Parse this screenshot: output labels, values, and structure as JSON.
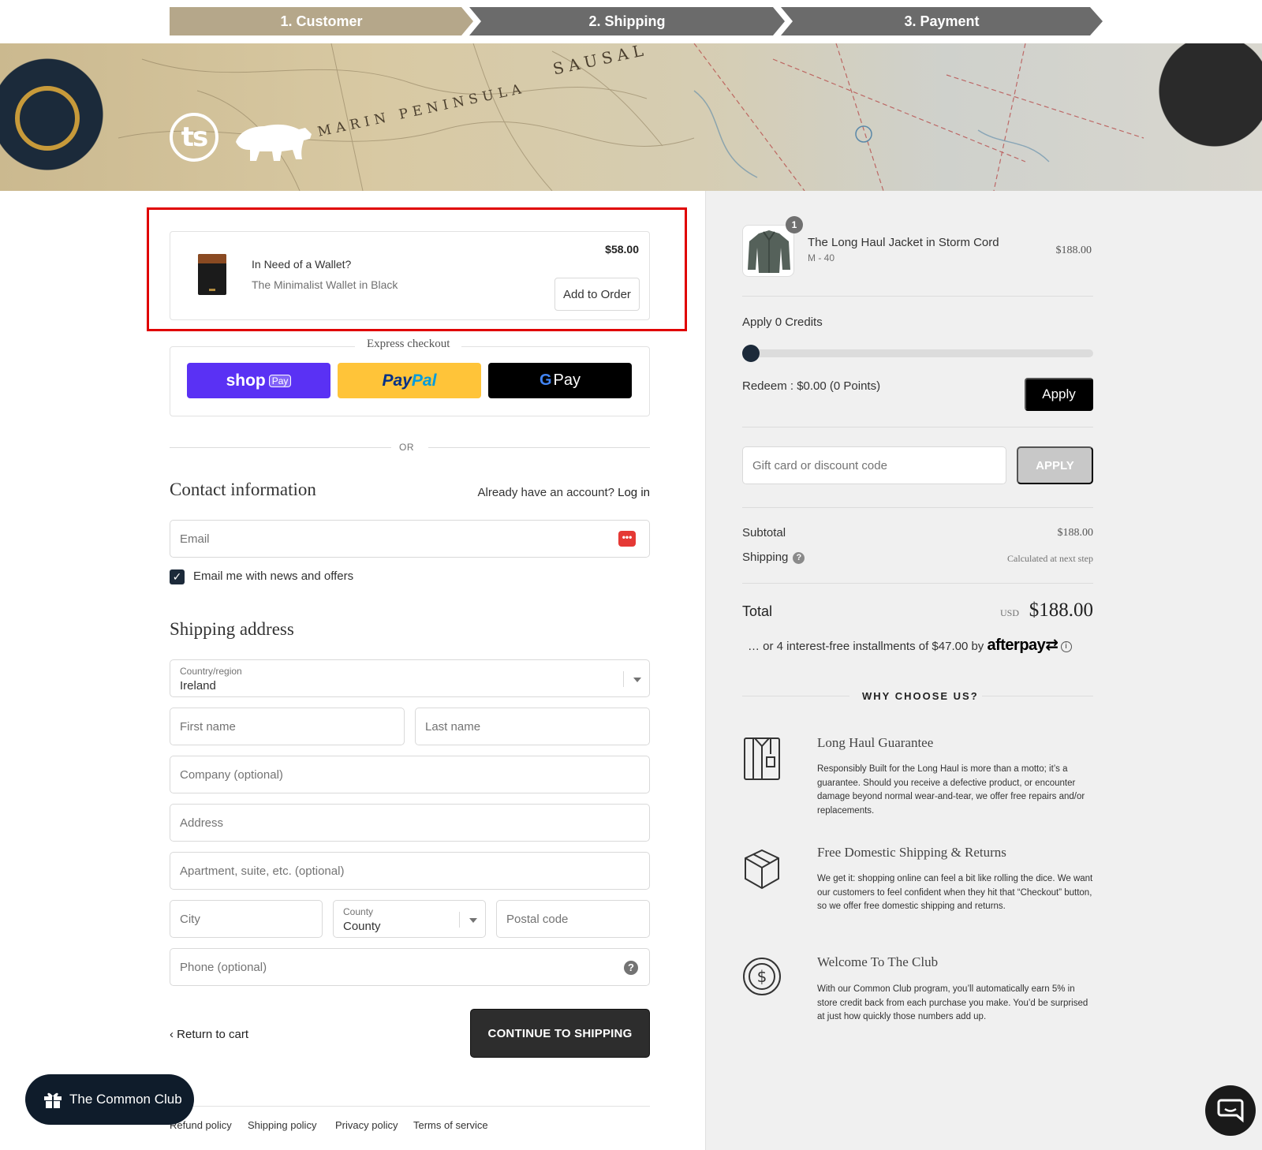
{
  "steps": [
    {
      "label": "1. Customer",
      "state": "active"
    },
    {
      "label": "2. Shipping",
      "state": "upcoming"
    },
    {
      "label": "3. Payment",
      "state": "upcoming"
    }
  ],
  "colors": {
    "step_active": "#b5a78a",
    "step_inactive": "#6b6b6b",
    "highlight_border": "#e00000",
    "shop_pay": "#5a31f4",
    "paypal": "#ffc439",
    "continue_button": "#2d2d2d",
    "right_panel_bg": "#f0f0f0"
  },
  "banner": {
    "logo_text": "ts",
    "icons": [
      "ts-logo-icon",
      "bear-icon"
    ],
    "map_labels": [
      "MARIN PENINSULA",
      "SAUSAL"
    ]
  },
  "upsell": {
    "title": "In Need of a Wallet?",
    "subtitle": "The Minimalist Wallet in Black",
    "price": "$58.00",
    "button_label": "Add to Order"
  },
  "express_checkout": {
    "label": "Express checkout",
    "buttons": {
      "shop": {
        "text": "shop",
        "tag": "Pay"
      },
      "paypal": {
        "part1": "Pay",
        "part2": "Pal"
      },
      "gpay": {
        "g": "G",
        "text": "Pay"
      }
    }
  },
  "divider": {
    "or_text": "OR"
  },
  "contact": {
    "title": "Contact information",
    "account_prompt": "Already have an account?",
    "login_link": "Log in",
    "email_placeholder": "Email",
    "newsletter_checked": true,
    "newsletter_label": "Email me with news and offers"
  },
  "shipping_address": {
    "title": "Shipping address",
    "country_label": "Country/region",
    "country_value": "Ireland",
    "first_name_placeholder": "First name",
    "last_name_placeholder": "Last name",
    "company_placeholder": "Company (optional)",
    "address_placeholder": "Address",
    "apartment_placeholder": "Apartment, suite, etc. (optional)",
    "city_placeholder": "City",
    "county_label": "County",
    "county_value": "County",
    "postal_placeholder": "Postal code",
    "phone_placeholder": "Phone (optional)"
  },
  "actions": {
    "return_label": "Return to cart",
    "continue_label": "CONTINUE TO SHIPPING"
  },
  "footer": {
    "links": [
      "Refund policy",
      "Shipping policy",
      "Privacy policy",
      "Terms of service"
    ]
  },
  "club_button": {
    "label": "The Common Club"
  },
  "order_summary": {
    "item": {
      "name": "The Long Haul Jacket in Storm Cord",
      "variant": "M - 40",
      "price": "$188.00",
      "quantity": "1"
    },
    "credits": {
      "label": "Apply 0 Credits",
      "slider_value": 0,
      "redeem_text": "Redeem : $0.00 (0 Points)",
      "apply_label": "Apply"
    },
    "discount": {
      "placeholder": "Gift card or discount code",
      "apply_label": "APPLY"
    },
    "subtotal_label": "Subtotal",
    "subtotal_value": "$188.00",
    "shipping_label": "Shipping",
    "shipping_help": "?",
    "shipping_value": "Calculated at next step",
    "total_label": "Total",
    "total_currency": "USD",
    "total_value": "$188.00",
    "afterpay": {
      "text": "… or 4 interest-free installments of $47.00 by",
      "logo": "afterpay",
      "info": "i"
    }
  },
  "why_choose": {
    "title": "WHY CHOOSE US?",
    "features": [
      {
        "icon": "shirt-icon",
        "title": "Long Haul Guarantee",
        "desc": "Responsibly Built for the Long Haul is more than a motto; it’s a guarantee. Should you receive a defective product, or encounter damage beyond normal wear-and-tear, we offer free repairs and/or replacements."
      },
      {
        "icon": "box-icon",
        "title": "Free Domestic Shipping & Returns",
        "desc": "We get it: shopping online can feel a bit like rolling the dice. We want our customers to feel confident when they hit that “Checkout” button, so we offer free domestic shipping and returns."
      },
      {
        "icon": "coin-icon",
        "title": "Welcome To The Club",
        "desc": "With our Common Club program, you’ll automatically earn 5% in store credit back from each purchase you make. You’d be surprised at just how quickly those numbers add up."
      }
    ]
  }
}
